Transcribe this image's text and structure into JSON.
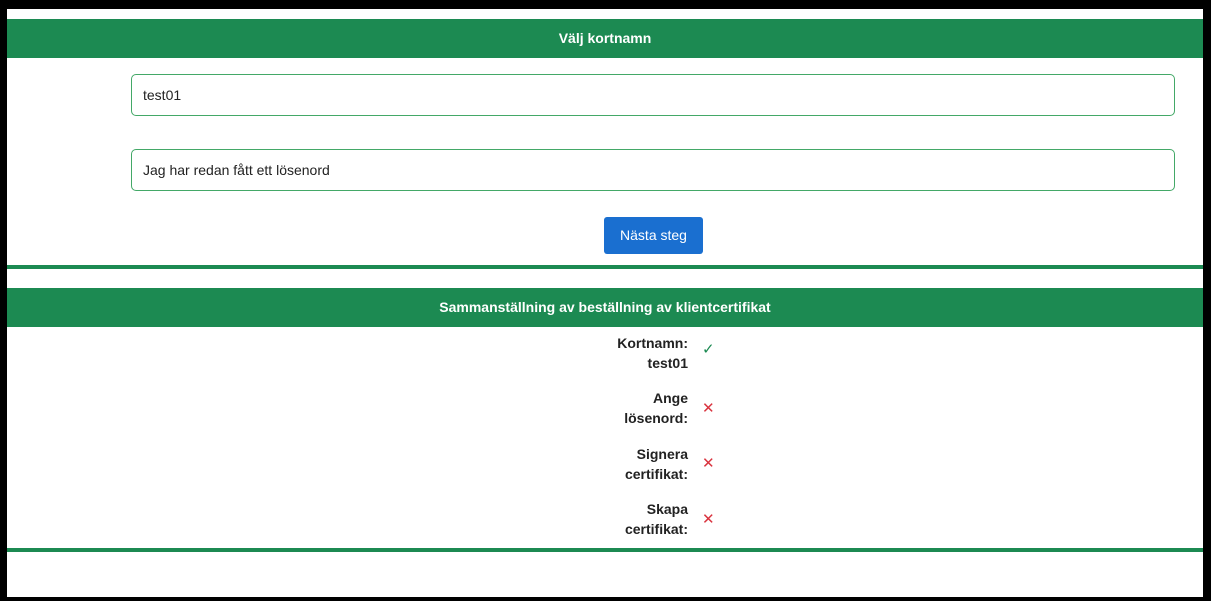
{
  "card_section": {
    "title": "Välj kortnamn",
    "card_name_value": "test01",
    "password_option_text": "Jag har redan fått ett lösenord",
    "next_button_label": "Nästa steg"
  },
  "summary_section": {
    "title": "Sammanställning av beställning av klientcertifikat",
    "rows": [
      {
        "line1": "Kortnamn:",
        "line2": "test01",
        "status": "ok",
        "icon": "check-icon",
        "glyph": "✓"
      },
      {
        "line1": "Ange",
        "line2": "lösenord:",
        "status": "no",
        "icon": "cross-icon",
        "glyph": "✕"
      },
      {
        "line1": "Signera",
        "line2": "certifikat:",
        "status": "no",
        "icon": "cross-icon",
        "glyph": "✕"
      },
      {
        "line1": "Skapa",
        "line2": "certifikat:",
        "status": "no",
        "icon": "cross-icon",
        "glyph": "✕"
      }
    ]
  },
  "colors": {
    "header_green": "#1c8a52",
    "button_blue": "#1a6fd0",
    "ok_green": "#1c8a52",
    "error_red": "#d9343f"
  }
}
